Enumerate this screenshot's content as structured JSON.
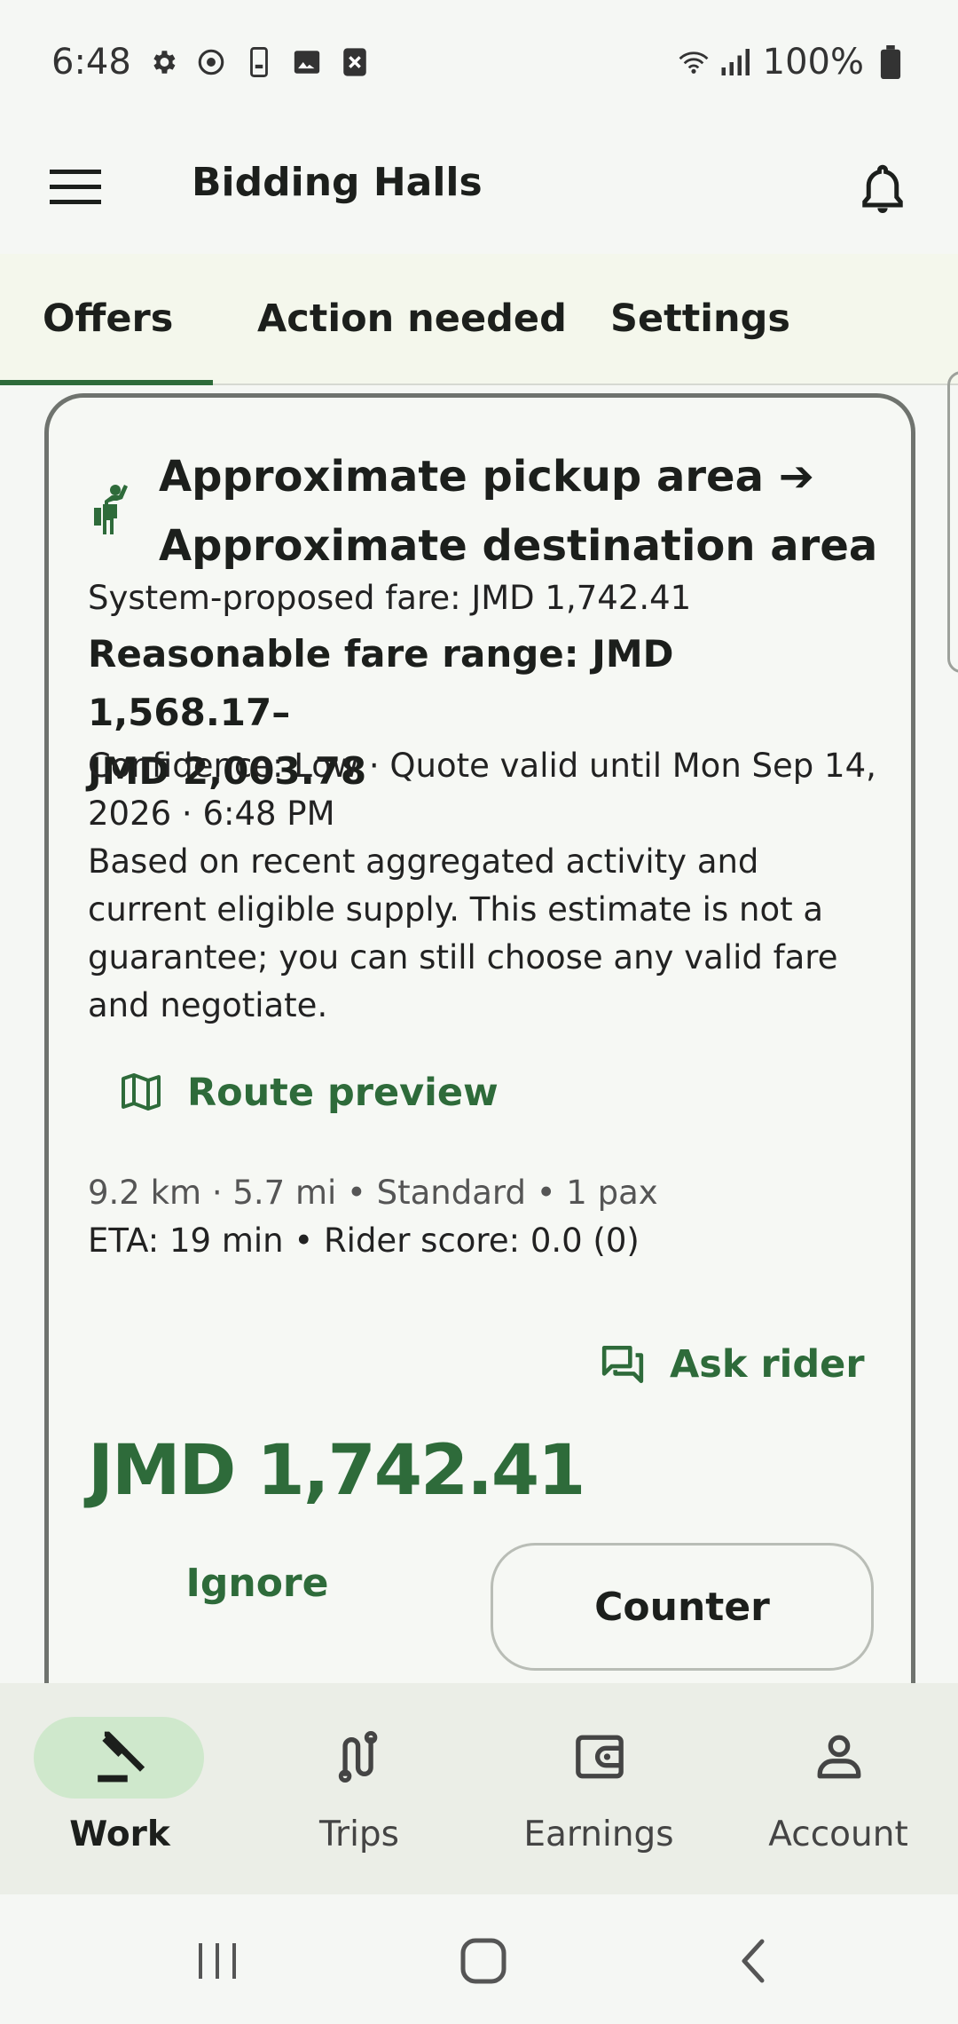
{
  "status_bar": {
    "time": "6:48",
    "battery": "100%",
    "icons": [
      "gear-icon",
      "sync-icon",
      "phone-icon",
      "image-icon",
      "close-box-icon",
      "wifi-icon",
      "signal-icon",
      "battery-icon"
    ]
  },
  "app_bar": {
    "title": "Bidding Halls"
  },
  "tabs": [
    {
      "label": "Offers",
      "active": true
    },
    {
      "label": "Action needed",
      "active": false
    },
    {
      "label": "Settings",
      "active": false
    }
  ],
  "offer": {
    "title_line1": "Approximate pickup area ➔",
    "title_line2": "Approximate destination area",
    "proposed_fare": "System-proposed fare: JMD 1,742.41",
    "fare_range_line1": "Reasonable fare range: JMD 1,568.17–",
    "fare_range_line2": "JMD 2,003.78",
    "confidence_line1": "Confidence: Low · Quote valid until Mon Sep 14,",
    "confidence_line2": "2026 · 6:48 PM",
    "disclaimer_line1": "Based on recent aggregated activity and",
    "disclaimer_line2": "current eligible supply. This estimate is not a",
    "disclaimer_line3": "guarantee; you can still choose any valid fare",
    "disclaimer_line4": "and negotiate.",
    "route_preview_label": "Route preview",
    "meta_line1": "9.2 km · 5.7 mi • Standard • 1 pax",
    "meta_line2": "ETA: 19 min • Rider score: 0.0 (0)",
    "ask_rider_label": "Ask rider",
    "price": "JMD 1,742.41",
    "ignore_label": "Ignore",
    "counter_label": "Counter"
  },
  "bottom_nav": [
    {
      "label": "Work",
      "icon": "gavel-icon",
      "active": true
    },
    {
      "label": "Trips",
      "icon": "route-icon",
      "active": false
    },
    {
      "label": "Earnings",
      "icon": "wallet-icon",
      "active": false
    },
    {
      "label": "Account",
      "icon": "person-icon",
      "active": false
    }
  ],
  "colors": {
    "accent": "#2e6b3a",
    "nav_active_pill": "#cfe8cc",
    "tab_bar_bg": "#f4f7ec"
  }
}
